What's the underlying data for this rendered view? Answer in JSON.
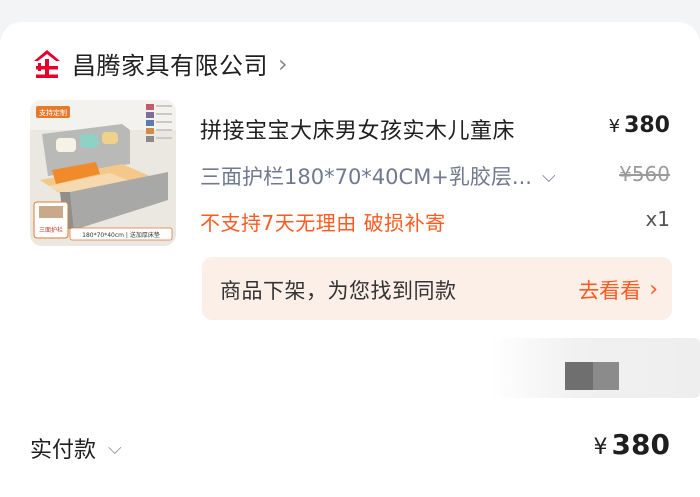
{
  "shop": {
    "name": "昌腾家具有限公司",
    "logo_icon": "shop-logo-icon",
    "chevron_icon": "chevron-right-icon",
    "brand_color": "#e4002b"
  },
  "product": {
    "image_badge": "支持定制",
    "image_caption": "180*70*40cm | 送加厚床垫",
    "image_corner": "三面护栏",
    "title": "拼接宝宝大床男女孩实木儿童床",
    "price_symbol": "¥",
    "price": "380",
    "spec": "三面护栏180*70*40CM+乳胶层...",
    "spec_chevron_icon": "chevron-down-icon",
    "original_price": "¥560",
    "policy": "不支持7天无理由  破损补寄",
    "quantity": "x1"
  },
  "notice": {
    "text": "商品下架，为您找到同款",
    "link_label": "去看看",
    "link_icon": "chevron-right-icon",
    "accent_color": "#ff5a1f"
  },
  "payment": {
    "label": "实付款",
    "chevron_icon": "chevron-down-icon",
    "symbol": "¥",
    "amount": "380"
  }
}
